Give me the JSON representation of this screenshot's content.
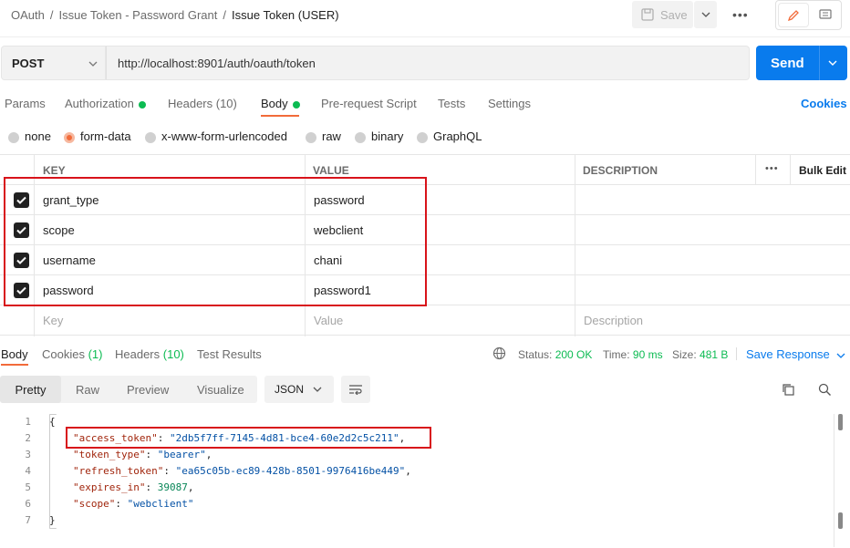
{
  "breadcrumb": [
    "OAuth",
    "Issue Token - Password Grant",
    "Issue Token (USER)"
  ],
  "toolbar": {
    "save_label": "Save"
  },
  "request": {
    "method": "POST",
    "url": "http://localhost:8901/auth/oauth/token",
    "send_label": "Send"
  },
  "req_tabs": [
    {
      "label": "Params"
    },
    {
      "label": "Authorization"
    },
    {
      "label": "Headers (10)"
    },
    {
      "label": "Body"
    },
    {
      "label": "Pre-request Script"
    },
    {
      "label": "Tests"
    },
    {
      "label": "Settings"
    }
  ],
  "cookies_label": "Cookies",
  "body_types": [
    "none",
    "form-data",
    "x-www-form-urlencoded",
    "raw",
    "binary",
    "GraphQL"
  ],
  "table": {
    "headers": {
      "key": "KEY",
      "value": "VALUE",
      "description": "DESCRIPTION",
      "bulk": "Bulk Edit"
    },
    "rows": [
      {
        "key": "grant_type",
        "value": "password"
      },
      {
        "key": "scope",
        "value": "webclient"
      },
      {
        "key": "username",
        "value": "chani"
      },
      {
        "key": "password",
        "value": "password1"
      }
    ],
    "placeholders": {
      "key": "Key",
      "value": "Value",
      "description": "Description"
    }
  },
  "response": {
    "tabs": [
      "Body",
      "Cookies",
      "(1)",
      "Headers",
      "(10)",
      "Test Results"
    ],
    "status_label": "Status:",
    "status": "200 OK",
    "time_label": "Time:",
    "time": "90 ms",
    "size_label": "Size:",
    "size": "481 B",
    "save_label": "Save Response",
    "views": [
      "Pretty",
      "Raw",
      "Preview",
      "Visualize"
    ],
    "format": "JSON",
    "lines": [
      "1",
      "2",
      "3",
      "4",
      "5",
      "6",
      "7"
    ],
    "json": {
      "open": "{",
      "close": "}",
      "access_token_key": "\"access_token\"",
      "access_token_val": "\"2db5f7ff-7145-4d81-bce4-60e2d2c5c211\"",
      "token_type_key": "\"token_type\"",
      "token_type_val": "\"bearer\"",
      "refresh_token_key": "\"refresh_token\"",
      "refresh_token_val": "\"ea65c05b-ec89-428b-8501-9976416be449\"",
      "expires_in_key": "\"expires_in\"",
      "expires_in_val": "39087",
      "scope_key": "\"scope\"",
      "scope_val": "\"webclient\""
    }
  },
  "colors": {
    "accent": "#097bed",
    "highlight": "#d8131a",
    "green": "#0cbb52",
    "orange": "#f26b3a"
  }
}
